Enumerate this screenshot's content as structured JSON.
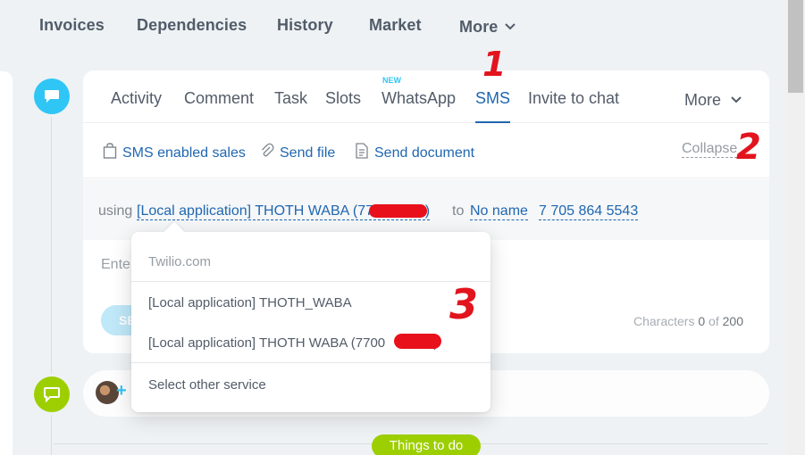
{
  "topnav": {
    "items": [
      "Invoices",
      "Dependencies",
      "History",
      "Market"
    ],
    "more": "More"
  },
  "editor": {
    "tabs": [
      "Activity",
      "Comment",
      "Task",
      "Slots",
      "WhatsApp",
      "SMS",
      "Invite to chat"
    ],
    "active_tab": "SMS",
    "new_badge": "NEW",
    "more": "More",
    "toolbar": {
      "sms_sales": "SMS enabled sales",
      "send_file": "Send file",
      "send_document": "Send document",
      "collapse": "Collapse"
    },
    "using": {
      "label": "using",
      "provider": "[Local application] THOTH WABA (77         90)",
      "to": "to",
      "recipient_name": "No name",
      "recipient_phone": "7 705 864 5543"
    },
    "placeholder": "Ente",
    "send_label": "SE",
    "chars": {
      "label": "Characters",
      "count": "0",
      "of": "of",
      "max": "200"
    }
  },
  "dropdown": {
    "header": "Twilio.com",
    "options": [
      "[Local application] THOTH_WABA",
      "[Local application] THOTH WABA (7700         90)"
    ],
    "other": "Select other service"
  },
  "todo": {
    "label": "Things to do"
  },
  "annotations": [
    "1",
    "2",
    "3"
  ],
  "colors": {
    "accent_blue": "#2067b0",
    "timeline_blue": "#2fc6f6",
    "timeline_green": "#9dcf00",
    "annotation_red": "#e2141e"
  }
}
